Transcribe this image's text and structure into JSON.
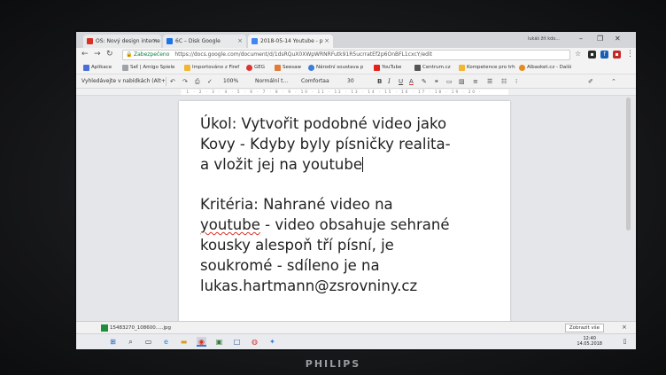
{
  "browser": {
    "tabs": [
      {
        "title": "OS: Nový design interne",
        "icon": "gmail-icon",
        "color": "#d93025"
      },
      {
        "title": "6C – Disk Google",
        "icon": "drive-icon",
        "color": "#1a73e8"
      },
      {
        "title": "2018-05-14 Youtube - p",
        "icon": "docs-icon",
        "color": "#4285f4"
      }
    ],
    "user_name": "lukáš žít kdo...",
    "address": {
      "secure_label": "Zabezpečeno",
      "url": "https://docs.google.com/document/d/1dsRQuX0XWpWRNRFutk91R5ucrratEf2p6OnBFL1cxcY/edit"
    },
    "bookmarks": [
      {
        "label": "Aplikace",
        "icon": "apps-icon"
      },
      {
        "label": "Seť | Amigo Spiele",
        "icon": "bookmark-icon"
      },
      {
        "label": "Importováno z Firef",
        "icon": "folder-icon"
      },
      {
        "label": "GEG",
        "icon": "geg-icon"
      },
      {
        "label": "Seesaw",
        "icon": "seesaw-icon"
      },
      {
        "label": "Národní soustava p",
        "icon": "bookmark-icon"
      },
      {
        "label": "YouTube",
        "icon": "youtube-icon"
      },
      {
        "label": "Centrum.cz",
        "icon": "bookmark-icon"
      },
      {
        "label": "Kompetence pro trh",
        "icon": "folder-icon"
      },
      {
        "label": "Albasket.cz - Dalši",
        "icon": "bookmark-icon"
      }
    ]
  },
  "docs_toolbar": {
    "search_menus": "Vyhledávejte v nabídkách (Alt+",
    "zoom": "100%",
    "style": "Normální t...",
    "font": "Comfortaa",
    "size": "30"
  },
  "document": {
    "lines_task": [
      "Úkol: Vytvořit podobné video jako",
      "Kovy - Kdyby byly písničky realita-",
      "a vložit jej na youtube"
    ],
    "criteria_intro": "Kritéria: Nahrané video na",
    "criteria_link_word": "youtube",
    "criteria_rest1": " - video obsahuje sehrané",
    "criteria_lines": [
      "kousky alespoň tří písní, je",
      "soukromé - sdíleno je na",
      "lukas.hartmann@zsrovniny.cz"
    ]
  },
  "downloads": {
    "file": "15483270_108600.....jpg",
    "show_all": "Zobrazit vše"
  },
  "taskbar": {
    "time": "12:40",
    "date": "14.05.2018"
  },
  "monitor": {
    "brand": "PHILIPS"
  }
}
